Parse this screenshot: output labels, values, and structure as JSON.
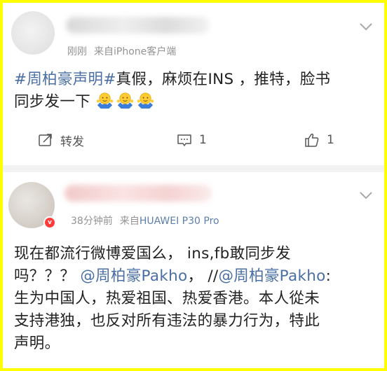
{
  "post1": {
    "time": "刚刚",
    "source_prefix": "来自",
    "source": "iPhone客户端",
    "topic": "#周柏豪声明#",
    "line1_text": "真假，麻烦在INS ，推特，脸书",
    "line2_text": "同步发一下",
    "emoji_name": "shrug",
    "actions": {
      "repost_label": "转发",
      "comment_count": "1",
      "like_count": "1"
    }
  },
  "post2": {
    "time": "38分钟前",
    "source_prefix": "来自",
    "source": "HUAWEI P30 Pro",
    "vip_badge": "v",
    "line1": "现在都流行微博爱国么， ins,fb敢同步发",
    "line2_start": "吗？？？ ",
    "mention1": "@周柏豪Pakho",
    "line2_middle": "， //",
    "mention2": "@周柏豪Pakho",
    "line2_end": ":",
    "line3": "生为中国人，热爱祖国、热爱香港。本人從未",
    "line4": "支持港独，也反对所有违法的暴力行为，特此",
    "line5": "声明。"
  },
  "colors": {
    "border": "#ffff00",
    "link": "#4a6fa5",
    "meta": "#939393",
    "separator": "#f2f2f2"
  }
}
